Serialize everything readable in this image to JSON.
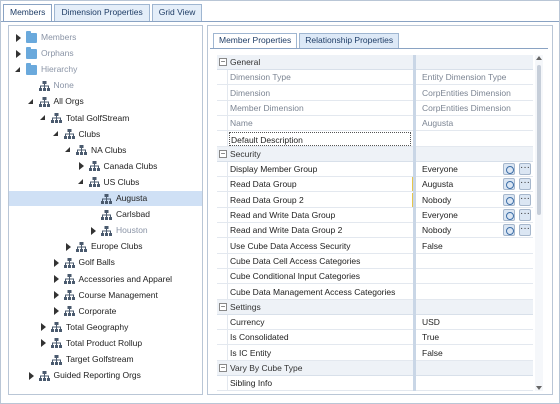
{
  "top_tabs": [
    "Members",
    "Dimension Properties",
    "Grid View"
  ],
  "tree": [
    {
      "label": "Members",
      "level": 0,
      "arrow": "collapsed",
      "icon": "folder-icon",
      "gray": true
    },
    {
      "label": "Orphans",
      "level": 0,
      "arrow": "collapsed",
      "icon": "folder-icon",
      "gray": true
    },
    {
      "label": "Hierarchy",
      "level": 0,
      "arrow": "expanded",
      "icon": "folder-icon",
      "gray": true
    },
    {
      "label": "None",
      "level": 1,
      "arrow": "none",
      "icon": "org-icon",
      "gray": true
    },
    {
      "label": "All Orgs",
      "level": 1,
      "arrow": "expanded",
      "icon": "org-icon"
    },
    {
      "label": "Total GolfStream",
      "level": 2,
      "arrow": "expanded",
      "icon": "org-icon"
    },
    {
      "label": "Clubs",
      "level": 3,
      "arrow": "expanded",
      "icon": "org-icon"
    },
    {
      "label": "NA Clubs",
      "level": 4,
      "arrow": "expanded",
      "icon": "org-icon"
    },
    {
      "label": "Canada Clubs",
      "level": 5,
      "arrow": "collapsed",
      "icon": "org-icon"
    },
    {
      "label": "US Clubs",
      "level": 5,
      "arrow": "expanded",
      "icon": "org-icon"
    },
    {
      "label": "Augusta",
      "level": 6,
      "arrow": "none",
      "icon": "org-icon",
      "selected": true
    },
    {
      "label": "Carlsbad",
      "level": 6,
      "arrow": "none",
      "icon": "org-icon"
    },
    {
      "label": "Houston",
      "level": 6,
      "arrow": "collapsed",
      "icon": "org-icon",
      "gray": true
    },
    {
      "label": "Europe Clubs",
      "level": 4,
      "arrow": "collapsed",
      "icon": "org-icon"
    },
    {
      "label": "Golf Balls",
      "level": 3,
      "arrow": "collapsed",
      "icon": "org-icon"
    },
    {
      "label": "Accessories and Apparel",
      "level": 3,
      "arrow": "collapsed",
      "icon": "org-icon"
    },
    {
      "label": "Course Management",
      "level": 3,
      "arrow": "collapsed",
      "icon": "org-icon"
    },
    {
      "label": "Corporate",
      "level": 3,
      "arrow": "collapsed",
      "icon": "org-icon"
    },
    {
      "label": "Total Geography",
      "level": 2,
      "arrow": "collapsed",
      "icon": "org-icon"
    },
    {
      "label": "Total Product Rollup",
      "level": 2,
      "arrow": "collapsed",
      "icon": "org-icon"
    },
    {
      "label": "Target Golfstream",
      "level": 2,
      "arrow": "none",
      "icon": "org-icon"
    },
    {
      "label": "Guided Reporting Orgs",
      "level": 1,
      "arrow": "collapsed",
      "icon": "org-icon"
    }
  ],
  "prop_tabs": [
    "Member Properties",
    "Relationship Properties"
  ],
  "grid": [
    {
      "type": "cat",
      "name": "General"
    },
    {
      "name": "Dimension Type",
      "value": "Entity Dimension Type",
      "dim": true
    },
    {
      "name": "Dimension",
      "value": "CorpEntities Dimension",
      "dim": true
    },
    {
      "name": "Member Dimension",
      "value": "CorpEntities Dimension",
      "dim": true
    },
    {
      "name": "Name",
      "value": "Augusta",
      "dim": true
    },
    {
      "name": "Default Description",
      "value": "",
      "focus": true
    },
    {
      "type": "cat",
      "name": "Security"
    },
    {
      "name": "Display Member Group",
      "value": "Everyone",
      "buttons": true
    },
    {
      "name": "Read Data Group",
      "value": "Augusta",
      "buttons": true,
      "hl": true
    },
    {
      "name": "Read Data Group 2",
      "value": "Nobody",
      "buttons": true,
      "hl": true
    },
    {
      "name": "Read and Write Data Group",
      "value": "Everyone",
      "buttons": true
    },
    {
      "name": "Read and Write Data Group 2",
      "value": "Nobody",
      "buttons": true
    },
    {
      "name": "Use Cube Data Access Security",
      "value": "False"
    },
    {
      "name": "Cube Data Cell Access Categories",
      "value": ""
    },
    {
      "name": "Cube Conditional Input Categories",
      "value": ""
    },
    {
      "name": "Cube Data Management Access Categories",
      "value": ""
    },
    {
      "type": "cat",
      "name": "Settings"
    },
    {
      "name": "Currency",
      "value": "USD"
    },
    {
      "name": "Is Consolidated",
      "value": "True"
    },
    {
      "name": "Is IC Entity",
      "value": "False"
    },
    {
      "type": "cat",
      "name": "Vary By Cube Type"
    },
    {
      "name": "Sibling Info",
      "value": ""
    }
  ]
}
